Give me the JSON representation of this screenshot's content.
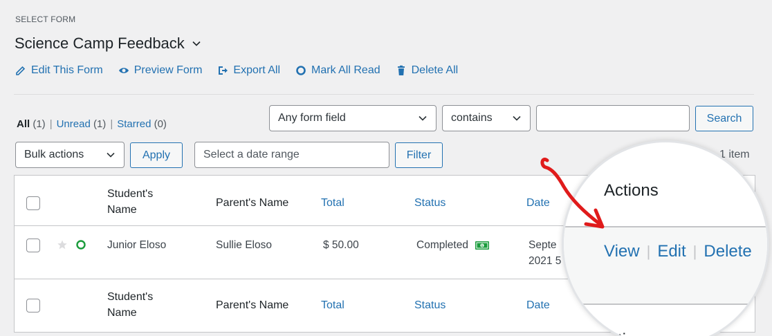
{
  "header": {
    "select_label": "SELECT FORM",
    "form_title": "Science Camp Feedback"
  },
  "form_actions": [
    {
      "label": "Edit This Form",
      "icon": "pencil-icon"
    },
    {
      "label": "Preview Form",
      "icon": "eye-icon"
    },
    {
      "label": "Export All",
      "icon": "export-icon"
    },
    {
      "label": "Mark All Read",
      "icon": "circle-icon"
    },
    {
      "label": "Delete All",
      "icon": "trash-icon"
    }
  ],
  "views": {
    "all": "All",
    "all_count": "(1)",
    "unread": "Unread",
    "unread_count": "(1)",
    "starred": "Starred",
    "starred_count": "(0)",
    "sep": "|"
  },
  "search": {
    "field_select": "Any form field",
    "operator_select": "contains",
    "input_value": "",
    "button": "Search"
  },
  "bulk": {
    "select": "Bulk actions",
    "apply": "Apply",
    "date_placeholder": "Select a date range",
    "filter": "Filter",
    "items_count": "1 item"
  },
  "table": {
    "columns": {
      "student_line1": "Student's",
      "student_line2": "Name",
      "parent": "Parent's Name",
      "total": "Total",
      "status": "Status",
      "date": "Date"
    },
    "row": {
      "student": "Junior Eloso",
      "parent": "Sullie Eloso",
      "total": "$ 50.00",
      "status": "Completed",
      "date_line1": "Septe",
      "date_line2": "2021 5"
    }
  },
  "magnified": {
    "actions_header": "Actions",
    "view": "View",
    "edit": "Edit",
    "delete": "Delete",
    "separator": "|",
    "footer_partial": "tions"
  },
  "colors": {
    "link": "#2271b1",
    "annotation_arrow": "#e01b1b",
    "status_icon": "#1a9c3c"
  }
}
